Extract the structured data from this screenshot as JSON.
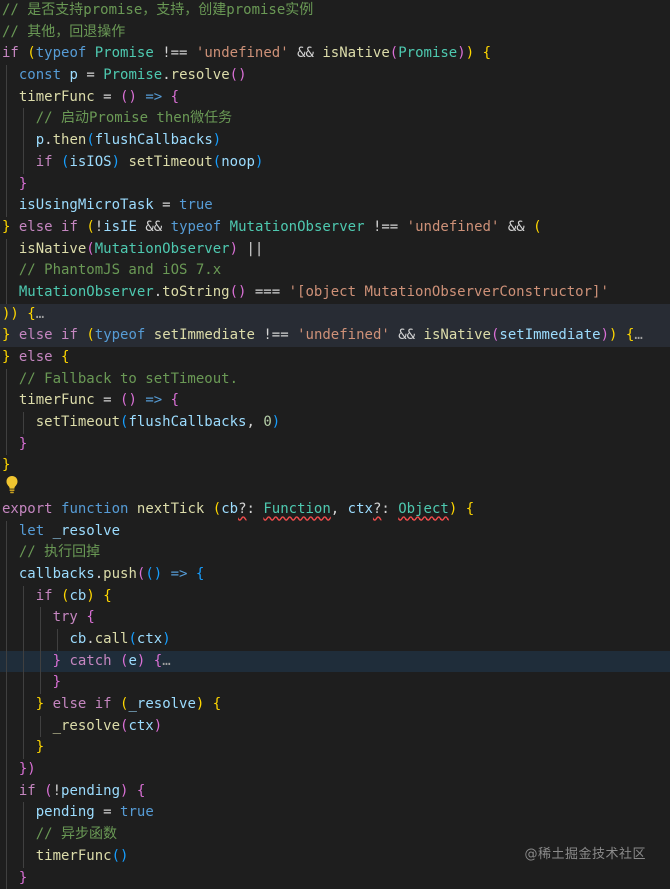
{
  "editor": {
    "lines": [
      [
        [
          "c-comment",
          "// 是否支持promise，支持，创建promise实例"
        ]
      ],
      [
        [
          "c-comment",
          "// 其他，回退操作"
        ]
      ],
      [
        [
          "c-ctrl",
          "if"
        ],
        [
          "c-plain",
          " "
        ],
        [
          "c-p1",
          "("
        ],
        [
          "c-kw",
          "typeof"
        ],
        [
          "c-plain",
          " "
        ],
        [
          "c-type",
          "Promise"
        ],
        [
          "c-plain",
          " !== "
        ],
        [
          "c-str",
          "'undefined'"
        ],
        [
          "c-plain",
          " && "
        ],
        [
          "c-fn",
          "isNative"
        ],
        [
          "c-p2",
          "("
        ],
        [
          "c-type",
          "Promise"
        ],
        [
          "c-p2",
          ")"
        ],
        [
          "c-p1",
          ")"
        ],
        [
          "c-plain",
          " "
        ],
        [
          "c-p1",
          "{"
        ]
      ],
      [
        [
          "c-plain",
          "  "
        ],
        [
          "c-kw",
          "const"
        ],
        [
          "c-plain",
          " "
        ],
        [
          "c-var",
          "p"
        ],
        [
          "c-plain",
          " = "
        ],
        [
          "c-type",
          "Promise"
        ],
        [
          "c-plain",
          "."
        ],
        [
          "c-fn",
          "resolve"
        ],
        [
          "c-p2",
          "()"
        ]
      ],
      [
        [
          "c-plain",
          "  "
        ],
        [
          "c-fn",
          "timerFunc"
        ],
        [
          "c-plain",
          " = "
        ],
        [
          "c-p2",
          "()"
        ],
        [
          "c-plain",
          " "
        ],
        [
          "c-kw",
          "=>"
        ],
        [
          "c-plain",
          " "
        ],
        [
          "c-p2",
          "{"
        ]
      ],
      [
        [
          "c-plain",
          "    "
        ],
        [
          "c-comment",
          "// 启动Promise then微任务"
        ]
      ],
      [
        [
          "c-plain",
          "    "
        ],
        [
          "c-var",
          "p"
        ],
        [
          "c-plain",
          "."
        ],
        [
          "c-fn",
          "then"
        ],
        [
          "c-p3",
          "("
        ],
        [
          "c-var",
          "flushCallbacks"
        ],
        [
          "c-p3",
          ")"
        ]
      ],
      [
        [
          "c-plain",
          "    "
        ],
        [
          "c-ctrl",
          "if"
        ],
        [
          "c-plain",
          " "
        ],
        [
          "c-p3",
          "("
        ],
        [
          "c-var",
          "isIOS"
        ],
        [
          "c-p3",
          ")"
        ],
        [
          "c-plain",
          " "
        ],
        [
          "c-fn",
          "setTimeout"
        ],
        [
          "c-p3",
          "("
        ],
        [
          "c-var",
          "noop"
        ],
        [
          "c-p3",
          ")"
        ]
      ],
      [
        [
          "c-plain",
          "  "
        ],
        [
          "c-p2",
          "}"
        ]
      ],
      [
        [
          "c-plain",
          "  "
        ],
        [
          "c-var",
          "isUsingMicroTask"
        ],
        [
          "c-plain",
          " = "
        ],
        [
          "c-kw",
          "true"
        ]
      ],
      [
        [
          "c-p1",
          "}"
        ],
        [
          "c-plain",
          " "
        ],
        [
          "c-ctrl",
          "else if"
        ],
        [
          "c-plain",
          " "
        ],
        [
          "c-p1",
          "("
        ],
        [
          "c-plain",
          "!"
        ],
        [
          "c-var",
          "isIE"
        ],
        [
          "c-plain",
          " && "
        ],
        [
          "c-kw",
          "typeof"
        ],
        [
          "c-plain",
          " "
        ],
        [
          "c-type",
          "MutationObserver"
        ],
        [
          "c-plain",
          " !== "
        ],
        [
          "c-str",
          "'undefined'"
        ],
        [
          "c-plain",
          " && "
        ],
        [
          "c-p1",
          "("
        ]
      ],
      [
        [
          "c-plain",
          "  "
        ],
        [
          "c-fn",
          "isNative"
        ],
        [
          "c-p2",
          "("
        ],
        [
          "c-type",
          "MutationObserver"
        ],
        [
          "c-p2",
          ")"
        ],
        [
          "c-plain",
          " ||"
        ]
      ],
      [
        [
          "c-plain",
          "  "
        ],
        [
          "c-comment",
          "// PhantomJS and iOS 7.x"
        ]
      ],
      [
        [
          "c-plain",
          "  "
        ],
        [
          "c-type",
          "MutationObserver"
        ],
        [
          "c-plain",
          "."
        ],
        [
          "c-fn",
          "toString"
        ],
        [
          "c-p2",
          "()"
        ],
        [
          "c-plain",
          " === "
        ],
        [
          "c-str",
          "'[object MutationObserverConstructor]'"
        ]
      ],
      [
        [
          "c-p1",
          "))"
        ],
        [
          "c-plain",
          " "
        ],
        [
          "c-p1",
          "{"
        ],
        [
          "c-fold",
          "…"
        ]
      ],
      [
        [
          "c-p1",
          "}"
        ],
        [
          "c-plain",
          " "
        ],
        [
          "c-ctrl",
          "else if"
        ],
        [
          "c-plain",
          " "
        ],
        [
          "c-p1",
          "("
        ],
        [
          "c-kw",
          "typeof"
        ],
        [
          "c-plain",
          " "
        ],
        [
          "c-fn",
          "setImmediate"
        ],
        [
          "c-plain",
          " !== "
        ],
        [
          "c-str",
          "'undefined'"
        ],
        [
          "c-plain",
          " && "
        ],
        [
          "c-fn",
          "isNative"
        ],
        [
          "c-p2",
          "("
        ],
        [
          "c-var",
          "setImmediate"
        ],
        [
          "c-p2",
          ")"
        ],
        [
          "c-p1",
          ")"
        ],
        [
          "c-plain",
          " "
        ],
        [
          "c-p1",
          "{"
        ],
        [
          "c-fold",
          "…"
        ]
      ],
      [
        [
          "c-p1",
          "}"
        ],
        [
          "c-plain",
          " "
        ],
        [
          "c-ctrl",
          "else"
        ],
        [
          "c-plain",
          " "
        ],
        [
          "c-p1",
          "{"
        ]
      ],
      [
        [
          "c-plain",
          "  "
        ],
        [
          "c-comment",
          "// Fallback to setTimeout."
        ]
      ],
      [
        [
          "c-plain",
          "  "
        ],
        [
          "c-fn",
          "timerFunc"
        ],
        [
          "c-plain",
          " = "
        ],
        [
          "c-p2",
          "()"
        ],
        [
          "c-plain",
          " "
        ],
        [
          "c-kw",
          "=>"
        ],
        [
          "c-plain",
          " "
        ],
        [
          "c-p2",
          "{"
        ]
      ],
      [
        [
          "c-plain",
          "    "
        ],
        [
          "c-fn",
          "setTimeout"
        ],
        [
          "c-p3",
          "("
        ],
        [
          "c-var",
          "flushCallbacks"
        ],
        [
          "c-plain",
          ", "
        ],
        [
          "c-num",
          "0"
        ],
        [
          "c-p3",
          ")"
        ]
      ],
      [
        [
          "c-plain",
          "  "
        ],
        [
          "c-p2",
          "}"
        ]
      ],
      [
        [
          "c-p1",
          "}"
        ]
      ],
      [],
      [
        [
          "c-ctrl",
          "export"
        ],
        [
          "c-plain",
          " "
        ],
        [
          "c-kw",
          "function"
        ],
        [
          "c-plain",
          " "
        ],
        [
          "c-fn",
          "nextTick"
        ],
        [
          "c-plain",
          " "
        ],
        [
          "c-p1",
          "("
        ],
        [
          "c-var",
          "cb"
        ],
        [
          "c-plain c-err",
          "?"
        ],
        [
          "c-plain",
          ": "
        ],
        [
          "c-type c-err",
          "Function"
        ],
        [
          "c-plain",
          ", "
        ],
        [
          "c-var",
          "ctx"
        ],
        [
          "c-plain c-err",
          "?"
        ],
        [
          "c-plain",
          ": "
        ],
        [
          "c-type c-err",
          "Object"
        ],
        [
          "c-p1",
          ")"
        ],
        [
          "c-plain",
          " "
        ],
        [
          "c-p1",
          "{"
        ]
      ],
      [
        [
          "c-plain",
          "  "
        ],
        [
          "c-kw",
          "let"
        ],
        [
          "c-plain",
          " "
        ],
        [
          "c-var",
          "_resolve"
        ]
      ],
      [
        [
          "c-plain",
          "  "
        ],
        [
          "c-comment",
          "// 执行回掉"
        ]
      ],
      [
        [
          "c-plain",
          "  "
        ],
        [
          "c-var",
          "callbacks"
        ],
        [
          "c-plain",
          "."
        ],
        [
          "c-fn",
          "push"
        ],
        [
          "c-p2",
          "("
        ],
        [
          "c-p3",
          "()"
        ],
        [
          "c-plain",
          " "
        ],
        [
          "c-kw",
          "=>"
        ],
        [
          "c-plain",
          " "
        ],
        [
          "c-p3",
          "{"
        ]
      ],
      [
        [
          "c-plain",
          "    "
        ],
        [
          "c-ctrl",
          "if"
        ],
        [
          "c-plain",
          " "
        ],
        [
          "c-p1",
          "("
        ],
        [
          "c-var",
          "cb"
        ],
        [
          "c-p1",
          ")"
        ],
        [
          "c-plain",
          " "
        ],
        [
          "c-p1",
          "{"
        ]
      ],
      [
        [
          "c-plain",
          "      "
        ],
        [
          "c-ctrl",
          "try"
        ],
        [
          "c-plain",
          " "
        ],
        [
          "c-p2",
          "{"
        ]
      ],
      [
        [
          "c-plain",
          "        "
        ],
        [
          "c-var",
          "cb"
        ],
        [
          "c-plain",
          "."
        ],
        [
          "c-fn",
          "call"
        ],
        [
          "c-p3",
          "("
        ],
        [
          "c-var",
          "ctx"
        ],
        [
          "c-p3",
          ")"
        ]
      ],
      [
        [
          "c-plain",
          "      "
        ],
        [
          "c-p2",
          "}"
        ],
        [
          "c-plain",
          " "
        ],
        [
          "c-ctrl",
          "catch"
        ],
        [
          "c-plain",
          " "
        ],
        [
          "c-p2",
          "("
        ],
        [
          "c-var",
          "e"
        ],
        [
          "c-p2",
          ")"
        ],
        [
          "c-plain",
          " "
        ],
        [
          "c-p2",
          "{"
        ],
        [
          "c-fold",
          "…"
        ]
      ],
      [
        [
          "c-plain",
          "      "
        ],
        [
          "c-p2",
          "}"
        ]
      ],
      [
        [
          "c-plain",
          "    "
        ],
        [
          "c-p1",
          "}"
        ],
        [
          "c-plain",
          " "
        ],
        [
          "c-ctrl",
          "else if"
        ],
        [
          "c-plain",
          " "
        ],
        [
          "c-p1",
          "("
        ],
        [
          "c-var",
          "_resolve"
        ],
        [
          "c-p1",
          ")"
        ],
        [
          "c-plain",
          " "
        ],
        [
          "c-p1",
          "{"
        ]
      ],
      [
        [
          "c-plain",
          "      "
        ],
        [
          "c-fn",
          "_resolve"
        ],
        [
          "c-p2",
          "("
        ],
        [
          "c-var",
          "ctx"
        ],
        [
          "c-p2",
          ")"
        ]
      ],
      [
        [
          "c-plain",
          "    "
        ],
        [
          "c-p1",
          "}"
        ]
      ],
      [
        [
          "c-plain",
          "  "
        ],
        [
          "c-p2",
          "})"
        ]
      ],
      [
        [
          "c-plain",
          "  "
        ],
        [
          "c-ctrl",
          "if"
        ],
        [
          "c-plain",
          " "
        ],
        [
          "c-p2",
          "("
        ],
        [
          "c-plain",
          "!"
        ],
        [
          "c-var",
          "pending"
        ],
        [
          "c-p2",
          ")"
        ],
        [
          "c-plain",
          " "
        ],
        [
          "c-p2",
          "{"
        ]
      ],
      [
        [
          "c-plain",
          "    "
        ],
        [
          "c-var",
          "pending"
        ],
        [
          "c-plain",
          " = "
        ],
        [
          "c-kw",
          "true"
        ]
      ],
      [
        [
          "c-plain",
          "    "
        ],
        [
          "c-comment",
          "// 异步函数"
        ]
      ],
      [
        [
          "c-plain",
          "    "
        ],
        [
          "c-fn",
          "timerFunc"
        ],
        [
          "c-p3",
          "()"
        ]
      ],
      [
        [
          "c-plain",
          "  "
        ],
        [
          "c-p2",
          "}"
        ]
      ]
    ],
    "highlighted_lines": [
      14,
      15
    ],
    "cursor_line": 30
  },
  "watermark": {
    "text": "@稀土掘金技术社区"
  },
  "icons": {
    "bulb": "lightbulb-icon"
  },
  "colors": {
    "background": "#1e1e1e",
    "comment": "#6a9955",
    "keyword": "#569cd6",
    "control": "#c586c0",
    "string": "#ce9178",
    "function": "#dcdcaa",
    "variable": "#9cdcfe",
    "type": "#4ec9b0",
    "bracket_gold": "#ffd700"
  }
}
